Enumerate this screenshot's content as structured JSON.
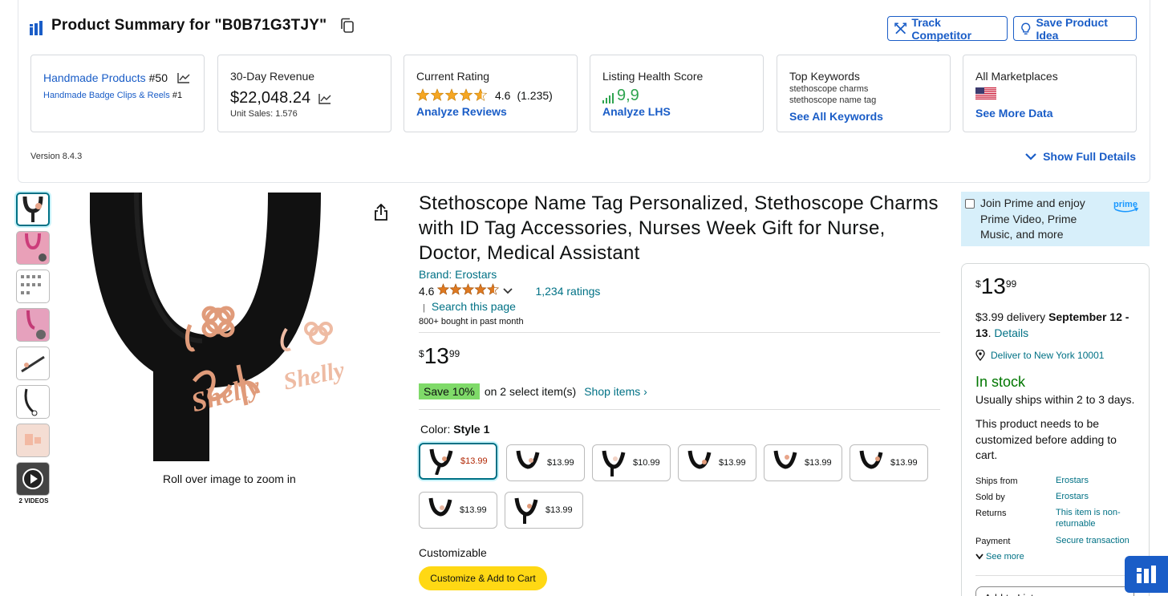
{
  "extension": {
    "title": "Product Summary for \"B0B71G3TJY\"",
    "track_label": "Track Competitor",
    "save_label": "Save Product Idea",
    "version": "Version 8.4.3",
    "show_full_label": "Show Full Details",
    "cards": {
      "category": {
        "main_link": "Handmade Products",
        "main_rank": "#50",
        "sub_link": "Handmade Badge Clips & Reels",
        "sub_rank": "#1"
      },
      "revenue": {
        "label": "30-Day Revenue",
        "value": "$22,048.24",
        "unit_sales": "Unit Sales:  1.576"
      },
      "rating": {
        "label": "Current Rating",
        "value": "4.6",
        "count": "(1.235)",
        "cta": "Analyze Reviews"
      },
      "health": {
        "label": "Listing Health Score",
        "value": "9,9",
        "cta": "Analyze LHS"
      },
      "keywords": {
        "label": "Top Keywords",
        "kw1": "stethoscope charms",
        "kw2": "stethoscope name tag",
        "cta": "See All Keywords"
      },
      "marketplaces": {
        "label": "All Marketplaces",
        "cta": "See More Data"
      }
    },
    "colors": {
      "accent": "#1a5dc7",
      "health_green": "#2ea44f"
    }
  },
  "gallery": {
    "videos_label": "2 VIDEOS",
    "roll_over": "Roll over image to zoom in"
  },
  "product": {
    "title": "Stethoscope Name Tag Personalized, Stethoscope Charms with ID Tag Accessories, Nurses Week Gift for Nurse, Doctor, Medical Assistant",
    "brand": "Brand: Erostars",
    "rating": "4.6",
    "ratings_count": "1,234 ratings",
    "search_page": "Search this page",
    "bought": "800+ bought in past month",
    "price": {
      "symbol": "$",
      "whole": "13",
      "fraction": "99"
    },
    "save_badge": "Save 10%",
    "save_text": "on 2 select item(s)",
    "shop_items": "Shop items ›",
    "color_label": "Color: ",
    "color_value": "Style 1",
    "swatches": [
      "$13.99",
      "$13.99",
      "$10.99",
      "$13.99",
      "$13.99",
      "$13.99",
      "$13.99",
      "$13.99"
    ],
    "customizable": "Customizable",
    "customize_button": "Customize & Add to Cart"
  },
  "buybox": {
    "prime_text": "Join Prime and enjoy Prime Video, Prime Music, and more",
    "prime_logo": "prime",
    "price": {
      "symbol": "$",
      "whole": "13",
      "fraction": "99"
    },
    "delivery_prefix": "$3.99 delivery ",
    "delivery_date": "September 12 - 13",
    "delivery_suffix": ". ",
    "details_link": "Details",
    "deliver_to": "Deliver to New York 10001",
    "stock": "In stock",
    "ships": "Usually ships within 2 to 3 days.",
    "customize_note": "This product needs to be customized before adding to cart.",
    "info": [
      {
        "k": "Ships from",
        "v": "Erostars"
      },
      {
        "k": "Sold by",
        "v": "Erostars"
      },
      {
        "k": "Returns",
        "v": "This item is non-returnable"
      },
      {
        "k": "Payment",
        "v": "Secure transaction"
      }
    ],
    "see_more": "See more",
    "add_to_list": "Add to List"
  }
}
